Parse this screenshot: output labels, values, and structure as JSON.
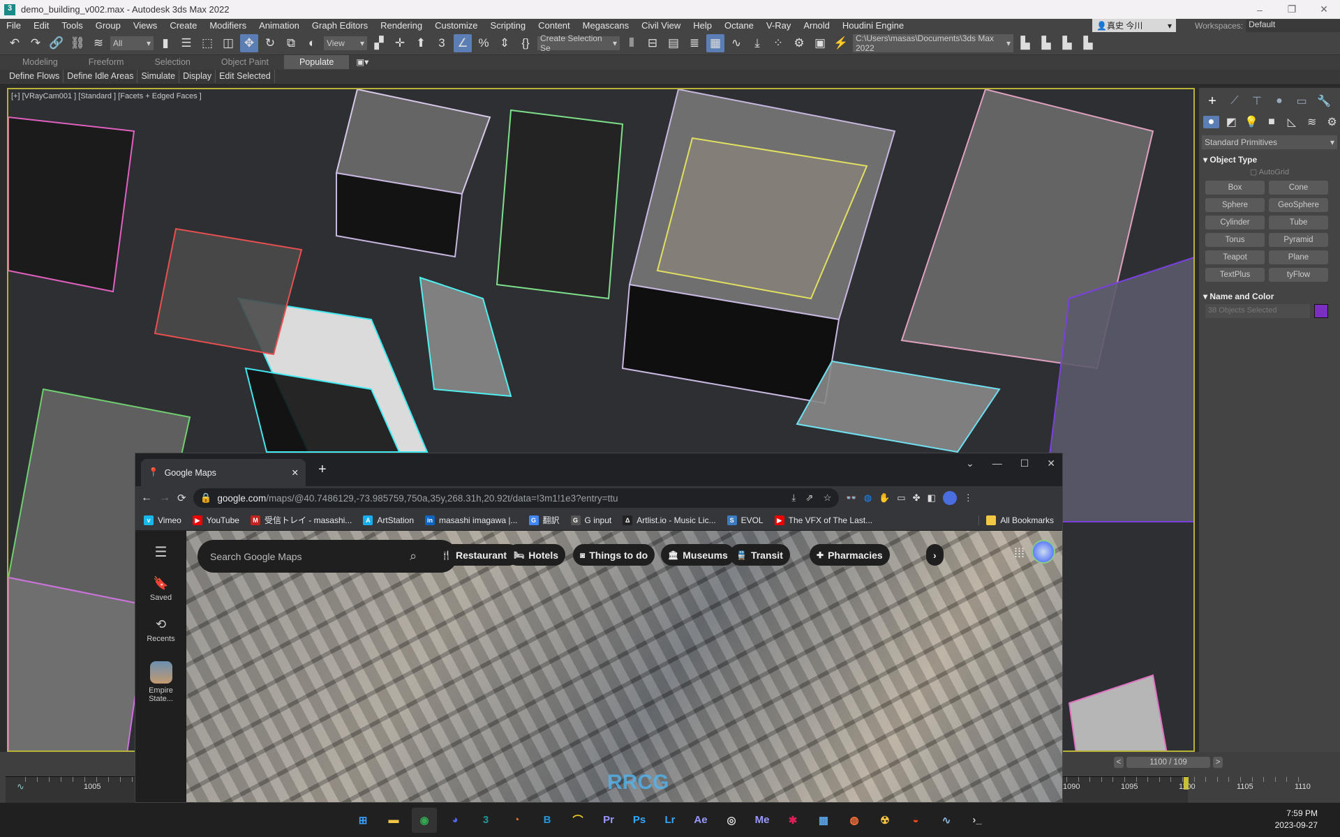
{
  "app": {
    "title": "demo_building_v002.max - Autodesk 3ds Max 2022",
    "window_controls": [
      "–",
      "❐",
      "✕"
    ]
  },
  "menu": [
    "File",
    "Edit",
    "Tools",
    "Group",
    "Views",
    "Create",
    "Modifiers",
    "Animation",
    "Graph Editors",
    "Rendering",
    "Customize",
    "Scripting",
    "Content",
    "Megascans",
    "Civil View",
    "Help",
    "Octane",
    "V-Ray",
    "Arnold",
    "Houdini Engine"
  ],
  "user": {
    "name": "真史 今川",
    "icon": "user-icon"
  },
  "workspaces": {
    "label": "Workspaces:",
    "value": "Default"
  },
  "toolbar": {
    "selection_filter": "All",
    "ref_coord": "View",
    "named_selection": "Create Selection Se",
    "project_path": "C:\\Users\\masas\\Documents\\3ds Max 2022",
    "icons_left": [
      {
        "name": "undo-icon",
        "g": "↶"
      },
      {
        "name": "redo-icon",
        "g": "↷"
      },
      {
        "name": "link-icon",
        "g": "🔗"
      },
      {
        "name": "unlink-icon",
        "g": "⛓"
      },
      {
        "name": "bind-space-warp-icon",
        "g": "≋"
      }
    ],
    "icons_mid": [
      {
        "name": "select-object-icon",
        "g": "▮"
      },
      {
        "name": "select-by-name-icon",
        "g": "☰"
      },
      {
        "name": "rect-selection-icon",
        "g": "⬚"
      },
      {
        "name": "window-crossing-icon",
        "g": "◫"
      },
      {
        "name": "move-icon",
        "g": "✥",
        "active": true
      },
      {
        "name": "rotate-icon",
        "g": "↻"
      },
      {
        "name": "scale-icon",
        "g": "⧉"
      },
      {
        "name": "placement-icon",
        "g": "◐"
      }
    ],
    "icons_mid2": [
      {
        "name": "pivot-icon",
        "g": "▞"
      },
      {
        "name": "select-manipulate-icon",
        "g": "✛"
      },
      {
        "name": "keyboard-shortcut-icon",
        "g": "⬆"
      },
      {
        "name": "snap-3d-icon",
        "g": "3"
      },
      {
        "name": "angle-snap-icon",
        "g": "∠",
        "active": true
      },
      {
        "name": "percent-snap-icon",
        "g": "%"
      },
      {
        "name": "spinner-snap-icon",
        "g": "⇕"
      },
      {
        "name": "edit-named-sets-icon",
        "g": "{}"
      }
    ],
    "icons_right": [
      {
        "name": "mirror-icon",
        "g": "⫴"
      },
      {
        "name": "align-icon",
        "g": "⊟"
      },
      {
        "name": "scene-explorer-icon",
        "g": "▤"
      },
      {
        "name": "layer-explorer-icon",
        "g": "≣"
      },
      {
        "name": "ribbon-toggle-icon",
        "g": "▦",
        "active": true
      },
      {
        "name": "curve-editor-icon",
        "g": "∿"
      },
      {
        "name": "schematic-icon",
        "g": "⤓"
      },
      {
        "name": "material-editor-icon",
        "g": "⁘"
      },
      {
        "name": "render-setup-icon",
        "g": "⚙"
      },
      {
        "name": "rendered-frame-icon",
        "g": "▣"
      },
      {
        "name": "render-icon",
        "g": "⚡"
      }
    ],
    "icons_far": [
      {
        "name": "project-folder-icon",
        "g": "▙"
      },
      {
        "name": "open-project-icon",
        "g": "▙"
      },
      {
        "name": "project-structure-icon",
        "g": "▙"
      },
      {
        "name": "project-settings-icon",
        "g": "▙"
      }
    ]
  },
  "ribbon": {
    "tabs": [
      "Modeling",
      "Freeform",
      "Selection",
      "Object Paint",
      "Populate"
    ],
    "selected": "Populate",
    "sub": [
      "Define Flows",
      "Define Idle Areas",
      "Simulate",
      "Display",
      "Edit Selected"
    ]
  },
  "viewport": {
    "label": "[+] [VRayCam001 ] [Standard ] [Facets + Edged Faces ]"
  },
  "command_panel": {
    "tabs": [
      "create-icon",
      "hierarchy-icon",
      "motion-icon",
      "display-icon",
      "utilities-icon",
      "modify-icon"
    ],
    "subtabs": [
      "geometry-icon",
      "shapes-icon",
      "lights-icon",
      "cameras-icon",
      "helpers-icon",
      "space-warps-icon",
      "systems-icon"
    ],
    "category": "Standard Primitives",
    "object_type": "Object Type",
    "autogrid": "AutoGrid",
    "buttons": [
      "Box",
      "Cone",
      "Sphere",
      "GeoSphere",
      "Cylinder",
      "Tube",
      "Torus",
      "Pyramid",
      "Teapot",
      "Plane",
      "TextPlus",
      "tyFlow"
    ],
    "name_and_color": "Name and Color",
    "name_field": "38 Objects Selected",
    "object_color": "#7a2fc0"
  },
  "timeline": {
    "frame_display": "1100 / 109",
    "prev": "<",
    "next": ">",
    "ticks_left": [
      "1005"
    ],
    "ticks_right": [
      "1090",
      "1095",
      "1100",
      "1105",
      "1110"
    ],
    "current_frame": 1100
  },
  "chrome": {
    "tab_title": "Google Maps",
    "new_tab": "+",
    "url_host": "google.com",
    "url_path": "/maps/@40.7486129,-73.985759,750a,35y,268.31h,20.92t/data=!3m1!1e3?entry=ttu",
    "bookmarks": [
      {
        "label": "Vimeo",
        "color": "#1ab7ea",
        "g": "v"
      },
      {
        "label": "YouTube",
        "color": "#e00",
        "g": "▶"
      },
      {
        "label": "受信トレイ - masashi...",
        "color": "#c5221f",
        "g": "M"
      },
      {
        "label": "ArtStation",
        "color": "#13aff0",
        "g": "A"
      },
      {
        "label": "masashi imagawa |...",
        "color": "#0a66c2",
        "g": "in"
      },
      {
        "label": "翻訳",
        "color": "#4285f4",
        "g": "G"
      },
      {
        "label": "G input",
        "color": "#555",
        "g": "G"
      },
      {
        "label": "Artlist.io - Music Lic...",
        "color": "#222",
        "g": "Δ"
      },
      {
        "label": "EVOL",
        "color": "#3b7bbf",
        "g": "S"
      },
      {
        "label": "The VFX of The Last...",
        "color": "#e00",
        "g": "▶"
      }
    ],
    "all_bookmarks": "All Bookmarks"
  },
  "maps": {
    "search_placeholder": "Search Google Maps",
    "side": [
      {
        "label": "Saved",
        "icon": "bookmark-icon",
        "g": "🔖"
      },
      {
        "label": "Recents",
        "icon": "history-icon",
        "g": "⟲"
      },
      {
        "label": "Empire State...",
        "icon": "place-thumbnail"
      }
    ],
    "chips": [
      {
        "label": "Restaurants",
        "g": "🍴"
      },
      {
        "label": "Hotels",
        "g": "🛏"
      },
      {
        "label": "Things to do",
        "g": "◙"
      },
      {
        "label": "Museums",
        "g": "🏛"
      },
      {
        "label": "Transit",
        "g": "🚆"
      },
      {
        "label": "Pharmacies",
        "g": "✚"
      }
    ],
    "more": "›"
  },
  "taskbar": {
    "apps": [
      {
        "name": "start",
        "g": "⊞",
        "c": "#3aa0ff"
      },
      {
        "name": "file-explorer",
        "g": "▬",
        "c": "#f2c744"
      },
      {
        "name": "chrome",
        "g": "◉",
        "c": "#34a853"
      },
      {
        "name": "discord",
        "g": "◕",
        "c": "#5865f2"
      },
      {
        "name": "3ds-max",
        "g": "3",
        "c": "#1d9a9a"
      },
      {
        "name": "blender",
        "g": "◔",
        "c": "#f5792a"
      },
      {
        "name": "app-b",
        "g": "B",
        "c": "#2596d8"
      },
      {
        "name": "app-arc",
        "g": "⌒",
        "c": "#f2d01f"
      },
      {
        "name": "premiere",
        "g": "Pr",
        "c": "#9999ff"
      },
      {
        "name": "photoshop",
        "g": "Ps",
        "c": "#31a8ff"
      },
      {
        "name": "lightroom",
        "g": "Lr",
        "c": "#31a8ff"
      },
      {
        "name": "after-effects",
        "g": "Ae",
        "c": "#9999ff"
      },
      {
        "name": "obs",
        "g": "◎",
        "c": "#ddd"
      },
      {
        "name": "media-encoder",
        "g": "Me",
        "c": "#9999ff"
      },
      {
        "name": "slack",
        "g": "✱",
        "c": "#e01e5a"
      },
      {
        "name": "control-panel",
        "g": "▩",
        "c": "#5aa0e0"
      },
      {
        "name": "firefox",
        "g": "◍",
        "c": "#ff7139"
      },
      {
        "name": "nuke",
        "g": "☢",
        "c": "#f5c542"
      },
      {
        "name": "houdini",
        "g": "◒",
        "c": "#ff4713"
      },
      {
        "name": "resource-monitor",
        "g": "∿",
        "c": "#8ab4d8"
      },
      {
        "name": "terminal",
        "g": "›_",
        "c": "#ccc"
      }
    ],
    "time": "7:59 PM",
    "date": "2023-09-27"
  }
}
